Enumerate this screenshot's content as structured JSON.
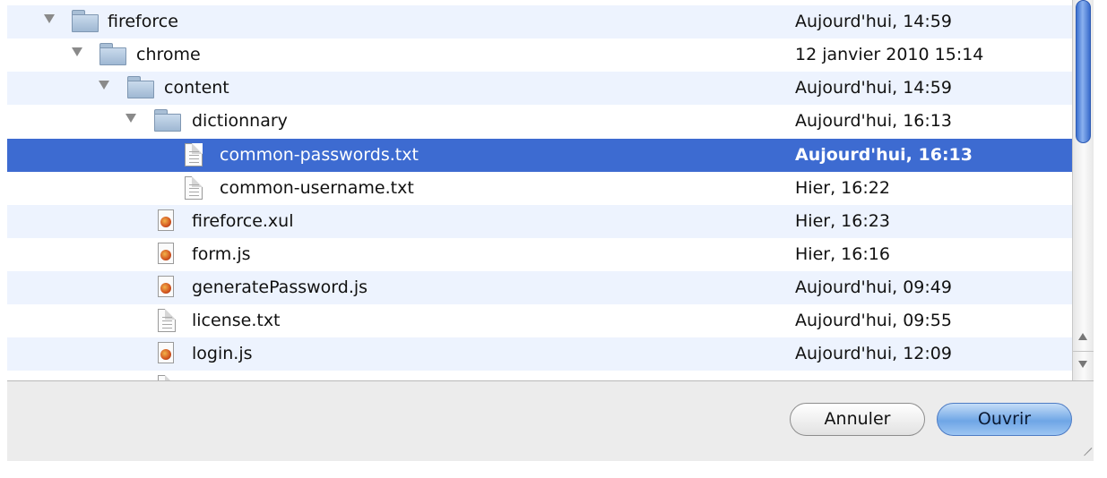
{
  "rows": [
    {
      "name": "fireforce",
      "date": "Aujourd'hui, 14:59"
    },
    {
      "name": "chrome",
      "date": "12 janvier 2010 15:14"
    },
    {
      "name": "content",
      "date": "Aujourd'hui, 14:59"
    },
    {
      "name": "dictionnary",
      "date": "Aujourd'hui, 16:13"
    },
    {
      "name": "common-passwords.txt",
      "date": "Aujourd'hui, 16:13"
    },
    {
      "name": "common-username.txt",
      "date": "Hier, 16:22"
    },
    {
      "name": "fireforce.xul",
      "date": "Hier, 16:23"
    },
    {
      "name": "form.js",
      "date": "Hier, 16:16"
    },
    {
      "name": "generatePassword.js",
      "date": "Aujourd'hui, 09:49"
    },
    {
      "name": "license.txt",
      "date": "Aujourd'hui, 09:55"
    },
    {
      "name": "login.js",
      "date": "Aujourd'hui, 12:09"
    }
  ],
  "buttons": {
    "cancel": "Annuler",
    "open": "Ouvrir"
  },
  "colors": {
    "selection": "#3d6bd1",
    "alt_row": "#edf3fe",
    "scroll_thumb": "#5a8de0"
  }
}
